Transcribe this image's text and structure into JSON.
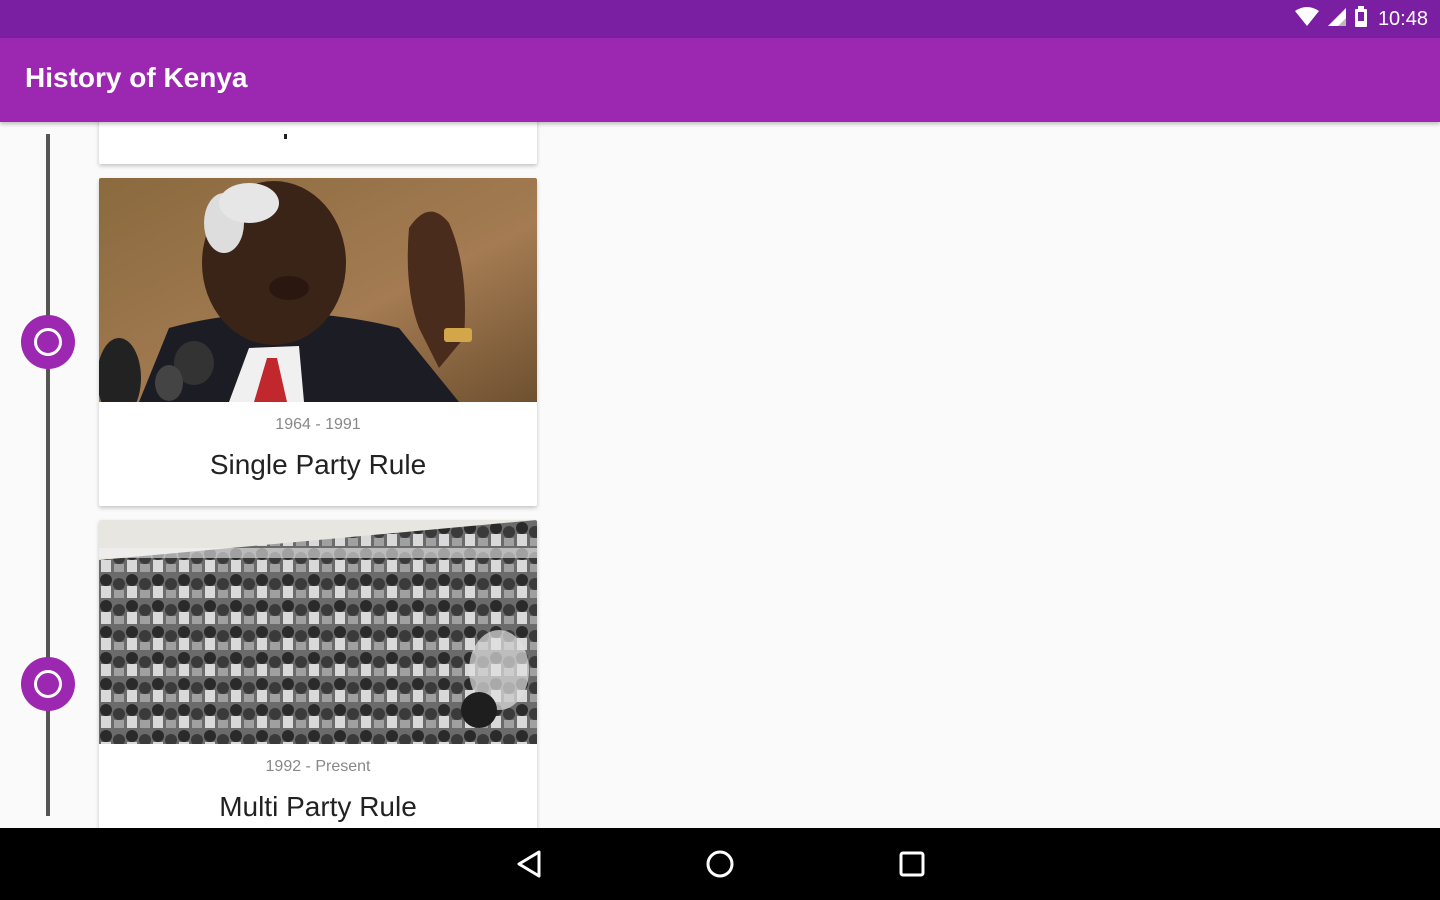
{
  "status_bar": {
    "time": "10:48",
    "icons": [
      "wifi-icon",
      "signal-icon",
      "battery-icon"
    ]
  },
  "app_bar": {
    "title": "History of Kenya"
  },
  "timeline": {
    "items": [
      {
        "date": "",
        "title": "",
        "image": "partial-card-above"
      },
      {
        "date": "1964 - 1991",
        "title": "Single Party Rule",
        "image": "president-speaking-photo"
      },
      {
        "date": "1992 - Present",
        "title": "Multi Party Rule",
        "image": "crowd-rally-photo"
      }
    ]
  },
  "nav_bar": {
    "buttons": [
      "back-icon",
      "home-icon",
      "recents-icon"
    ]
  },
  "colors": {
    "status_bar": "#7b1fa2",
    "app_bar": "#9c27b0",
    "accent": "#9c27b0",
    "timeline_line": "#555555"
  }
}
